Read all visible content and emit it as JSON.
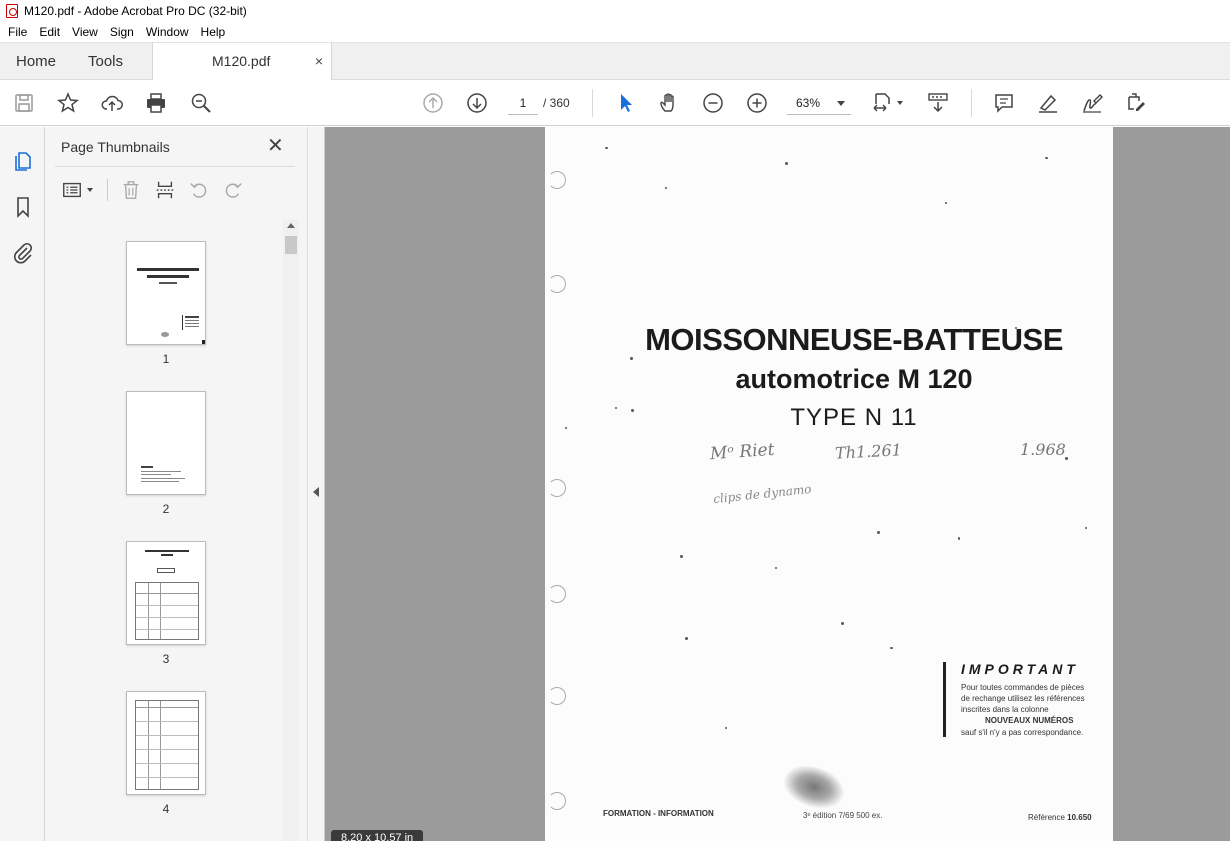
{
  "window": {
    "title": "M120.pdf - Adobe Acrobat Pro DC (32-bit)"
  },
  "menu": [
    "File",
    "Edit",
    "View",
    "Sign",
    "Window",
    "Help"
  ],
  "tabs": {
    "home": "Home",
    "tools": "Tools",
    "document": "M120.pdf",
    "close": "×"
  },
  "toolbar": {
    "page_current": "1",
    "page_total": "/ 360",
    "zoom": "63%"
  },
  "panel": {
    "title": "Page Thumbnails",
    "close": "✕",
    "thumbnails": [
      {
        "label": "1"
      },
      {
        "label": "2"
      },
      {
        "label": "3"
      },
      {
        "label": "4"
      }
    ]
  },
  "document": {
    "page_size": "8.20 x 10.57 in",
    "title_line1": "MOISSONNEUSE-BATTEUSE",
    "title_line2": "automotrice M 120",
    "title_line3": "TYPE N 11",
    "handwriting": {
      "line1_a": "Mᵒ Riet",
      "line1_b": "Th1.261",
      "line1_c": "1.968",
      "line2": "clips de dynamo"
    },
    "important": {
      "heading": "IMPORTANT",
      "line1": "Pour toutes commandes de pièces",
      "line2": "de rechange utilisez les références",
      "line3": "inscrites dans la colonne",
      "line4": "NOUVEAUX NUMÉROS",
      "line5": "sauf s'il n'y a pas correspondance."
    },
    "footer": {
      "left": "FORMATION - INFORMATION",
      "middle": "3ᵉ édition 7/69 500 ex.",
      "right_label": "Référence",
      "right_value": "10.650"
    }
  }
}
